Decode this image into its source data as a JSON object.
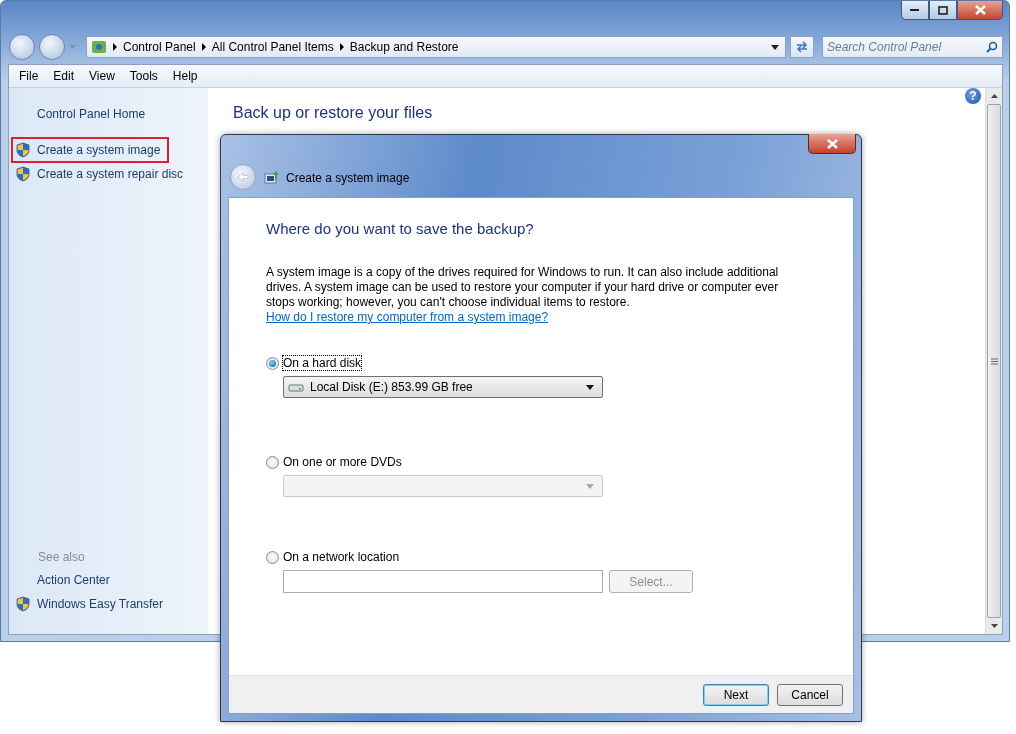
{
  "address_bar": {
    "breadcrumbs": [
      "Control Panel",
      "All Control Panel Items",
      "Backup and Restore"
    ]
  },
  "search": {
    "placeholder": "Search Control Panel"
  },
  "menu": [
    "File",
    "Edit",
    "View",
    "Tools",
    "Help"
  ],
  "sidebar": {
    "items": [
      {
        "label": "Control Panel Home",
        "shield": false,
        "highlighted": false
      },
      {
        "label": "Create a system image",
        "shield": true,
        "highlighted": true
      },
      {
        "label": "Create a system repair disc",
        "shield": true,
        "highlighted": false
      }
    ],
    "see_also": {
      "title": "See also",
      "items": [
        {
          "label": "Action Center",
          "shield": false
        },
        {
          "label": "Windows Easy Transfer",
          "shield": true
        }
      ]
    }
  },
  "content": {
    "title": "Back up or restore your files",
    "help": "?"
  },
  "dialog": {
    "title": "Create a system image",
    "heading": "Where do you want to save the backup?",
    "description": "A system image is a copy of the drives required for Windows to run. It can also include additional drives. A system image can be used to restore your computer if your hard drive or computer ever stops working; however, you can't choose individual items to restore.",
    "help_link": "How do I restore my computer from a system image?",
    "options": [
      {
        "label": "On a hard disk",
        "selected": true,
        "focused": true,
        "kind": "dropdown",
        "value": "Local Disk (E:)  853.99 GB free",
        "disabled": false
      },
      {
        "label": "On one or more DVDs",
        "selected": false,
        "focused": false,
        "kind": "dropdown",
        "disabled": true
      },
      {
        "label": "On a network location",
        "selected": false,
        "focused": false,
        "kind": "text-field",
        "disabled": false,
        "button": {
          "label": "Select...",
          "disabled": true
        }
      }
    ],
    "buttons": [
      {
        "label": "Next",
        "default": true
      },
      {
        "label": "Cancel",
        "default": false
      }
    ]
  }
}
